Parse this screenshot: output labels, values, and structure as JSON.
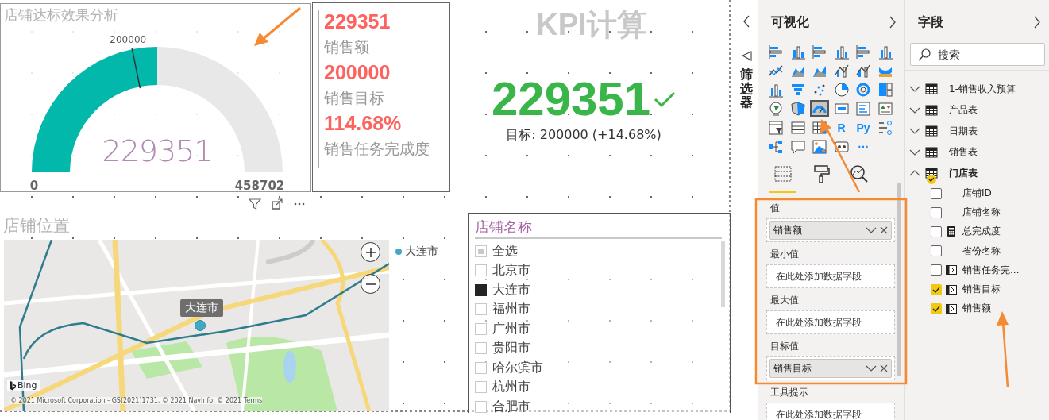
{
  "canvas": {
    "gauge": {
      "title": "店铺达标效果分析",
      "target": "200000",
      "value": "229351",
      "min": "0",
      "max": "458702",
      "level": 0.5
    },
    "cards": [
      {
        "value": "229351",
        "label": "销售额"
      },
      {
        "value": "200000",
        "label": "销售目标"
      },
      {
        "value": "114.68%",
        "label": "销售任务完成度"
      }
    ],
    "kpi": {
      "title": "KPI计算",
      "value": "229351",
      "goal_met": true,
      "goal_text": "目标: 200000 (+14.68%)"
    },
    "map": {
      "title": "店铺位置",
      "tooltip": "大连市",
      "legend": [
        {
          "label": "大连市",
          "color": "#41a9c4"
        }
      ],
      "attribution": "Bing",
      "copyright": "© 2021 Microsoft Corporation - GS(2021)1731, © 2021 NavInfo, © 2021 Terms"
    },
    "slicer": {
      "title": "店铺名称",
      "items": [
        {
          "label": "全选",
          "checked": false,
          "partial": true
        },
        {
          "label": "北京市",
          "checked": false,
          "partial": false
        },
        {
          "label": "大连市",
          "checked": true,
          "partial": false
        },
        {
          "label": "福州市",
          "checked": false,
          "partial": false
        },
        {
          "label": "广州市",
          "checked": false,
          "partial": false
        },
        {
          "label": "贵阳市",
          "checked": false,
          "partial": false
        },
        {
          "label": "哈尔滨市",
          "checked": false,
          "partial": false
        },
        {
          "label": "杭州市",
          "checked": false,
          "partial": false
        },
        {
          "label": "合肥市",
          "checked": false,
          "partial": false
        }
      ]
    }
  },
  "filters_pane": {
    "label": "筛选器"
  },
  "visualizations": {
    "title": "可视化",
    "icons": [
      {
        "kind": "hbar",
        "selected": false
      },
      {
        "kind": "vbar",
        "selected": false
      },
      {
        "kind": "hbar",
        "selected": false
      },
      {
        "kind": "vbar",
        "selected": false
      },
      {
        "kind": "hbar",
        "selected": false
      },
      {
        "kind": "vbar",
        "selected": false
      },
      {
        "kind": "line",
        "selected": false
      },
      {
        "kind": "area",
        "selected": false
      },
      {
        "kind": "area",
        "selected": false
      },
      {
        "kind": "combo",
        "selected": false
      },
      {
        "kind": "combo",
        "selected": false
      },
      {
        "kind": "ribbon",
        "selected": false
      },
      {
        "kind": "vbar",
        "selected": false
      },
      {
        "kind": "funnel",
        "selected": false
      },
      {
        "kind": "scatter",
        "selected": false
      },
      {
        "kind": "pie",
        "selected": false
      },
      {
        "kind": "donut",
        "selected": false
      },
      {
        "kind": "treemap",
        "selected": false
      },
      {
        "kind": "globe",
        "selected": false
      },
      {
        "kind": "filledmap",
        "selected": false
      },
      {
        "kind": "gauge",
        "selected": true
      },
      {
        "kind": "card",
        "selected": false
      },
      {
        "kind": "list",
        "selected": false
      },
      {
        "kind": "kpi",
        "selected": false
      },
      {
        "kind": "slicer",
        "selected": false
      },
      {
        "kind": "table",
        "selected": false
      },
      {
        "kind": "matrix",
        "selected": false
      },
      {
        "kind": "glyph",
        "glyph": "R",
        "selected": false
      },
      {
        "kind": "glyph",
        "glyph": "Py",
        "selected": false
      },
      {
        "kind": "influencers",
        "selected": false
      },
      {
        "kind": "tree",
        "selected": false
      },
      {
        "kind": "chat",
        "selected": false
      },
      {
        "kind": "arcmap",
        "selected": false
      },
      {
        "kind": "custom",
        "selected": false
      },
      {
        "kind": "glyph",
        "glyph": "⋯",
        "selected": false
      }
    ],
    "tabs": [
      {
        "kind": "fields",
        "selected": true
      },
      {
        "kind": "format",
        "selected": false
      },
      {
        "kind": "analytics",
        "selected": false
      }
    ],
    "wells": [
      {
        "label": "值",
        "field": "销售额"
      },
      {
        "label": "最小值",
        "placeholder": "在此处添加数据字段"
      },
      {
        "label": "最大值",
        "placeholder": "在此处添加数据字段"
      },
      {
        "label": "目标值",
        "field": "销售目标"
      },
      {
        "label": "工具提示",
        "placeholder": "在此处添加数据字段"
      }
    ]
  },
  "fields": {
    "title": "字段",
    "search_placeholder": "搜索",
    "tables": [
      {
        "label": "1-销售收入预算",
        "expanded": false,
        "in_use": false
      },
      {
        "label": "产品表",
        "expanded": false,
        "in_use": false
      },
      {
        "label": "日期表",
        "expanded": false,
        "in_use": false
      },
      {
        "label": "销售表",
        "expanded": false,
        "in_use": false
      },
      {
        "label": "门店表",
        "expanded": true,
        "in_use": true,
        "children": [
          {
            "label": "店铺ID",
            "kind": "column",
            "checked": false
          },
          {
            "label": "店铺名称",
            "kind": "column",
            "checked": false
          },
          {
            "label": "总完成度",
            "kind": "calculator",
            "checked": false
          },
          {
            "label": "省份名称",
            "kind": "column",
            "checked": false
          },
          {
            "label": "销售任务完...",
            "kind": "measure",
            "checked": false
          },
          {
            "label": "销售目标",
            "kind": "measure",
            "checked": true
          },
          {
            "label": "销售额",
            "kind": "measure",
            "checked": true
          }
        ]
      }
    ]
  },
  "annotations": [
    {
      "kind": "arrow"
    },
    {
      "kind": "arrow"
    },
    {
      "kind": "arrow"
    },
    {
      "kind": "frame"
    }
  ]
}
